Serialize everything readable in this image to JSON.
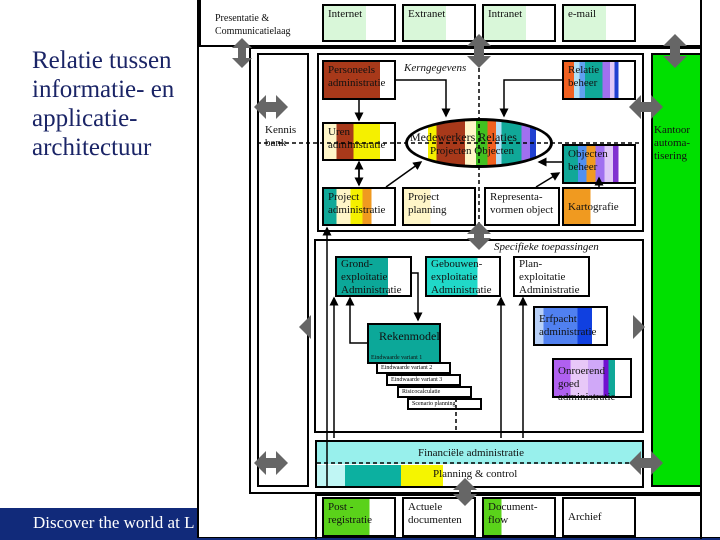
{
  "slide": {
    "title": "Relatie tussen informatie- en applicatie-architectuur",
    "footer": "Discover the world at L",
    "footer_color": "#112a7a"
  },
  "diagram": {
    "presentation_layer": "Presentatie & Communicatielaag",
    "channels": [
      "Internet",
      "Extranet",
      "Intranet",
      "e-mail"
    ],
    "kennis_bank": "Kennis bank",
    "kantoor": "Kantoor automa-tisering",
    "kerngegevens": {
      "label": "Kerngegevens",
      "personeels": "Personeels administratie",
      "relatie_beheer": "Relatie beheer",
      "uren": "Uren administratie",
      "ellipse_top": "Medewerkers Relaties",
      "ellipse_bottom": "Projecten  Objecten",
      "objecten_beheer": "Objecten beheer",
      "project_admin": "Project administratie",
      "project_planning": "Project planning",
      "representa": "Representa-vormen object",
      "kartografie": "Kartografie"
    },
    "specifiek": {
      "label": "Specifieke toepassingen",
      "grond": "Grond-exploitatie Administratie",
      "gebouwen": "Gebouwen-exploitatie Administratie",
      "plan": "Plan-exploitatie Administratie",
      "erfpacht": "Erfpacht administratie",
      "rekenmodel": "Rekenmodel",
      "stack": [
        "Eindwaarde variant 1",
        "Eindwaarde variant 2",
        "Eindwaarde variant 3",
        "Risicocalculatie",
        "Scenario planning"
      ],
      "onroerend": "Onroerend goed administratie"
    },
    "financieel": "Financiële administratie",
    "planning": "Planning & control",
    "document_layer": [
      "Post - registratie",
      "Actuele documenten",
      "Document-flow",
      "Archief"
    ]
  }
}
